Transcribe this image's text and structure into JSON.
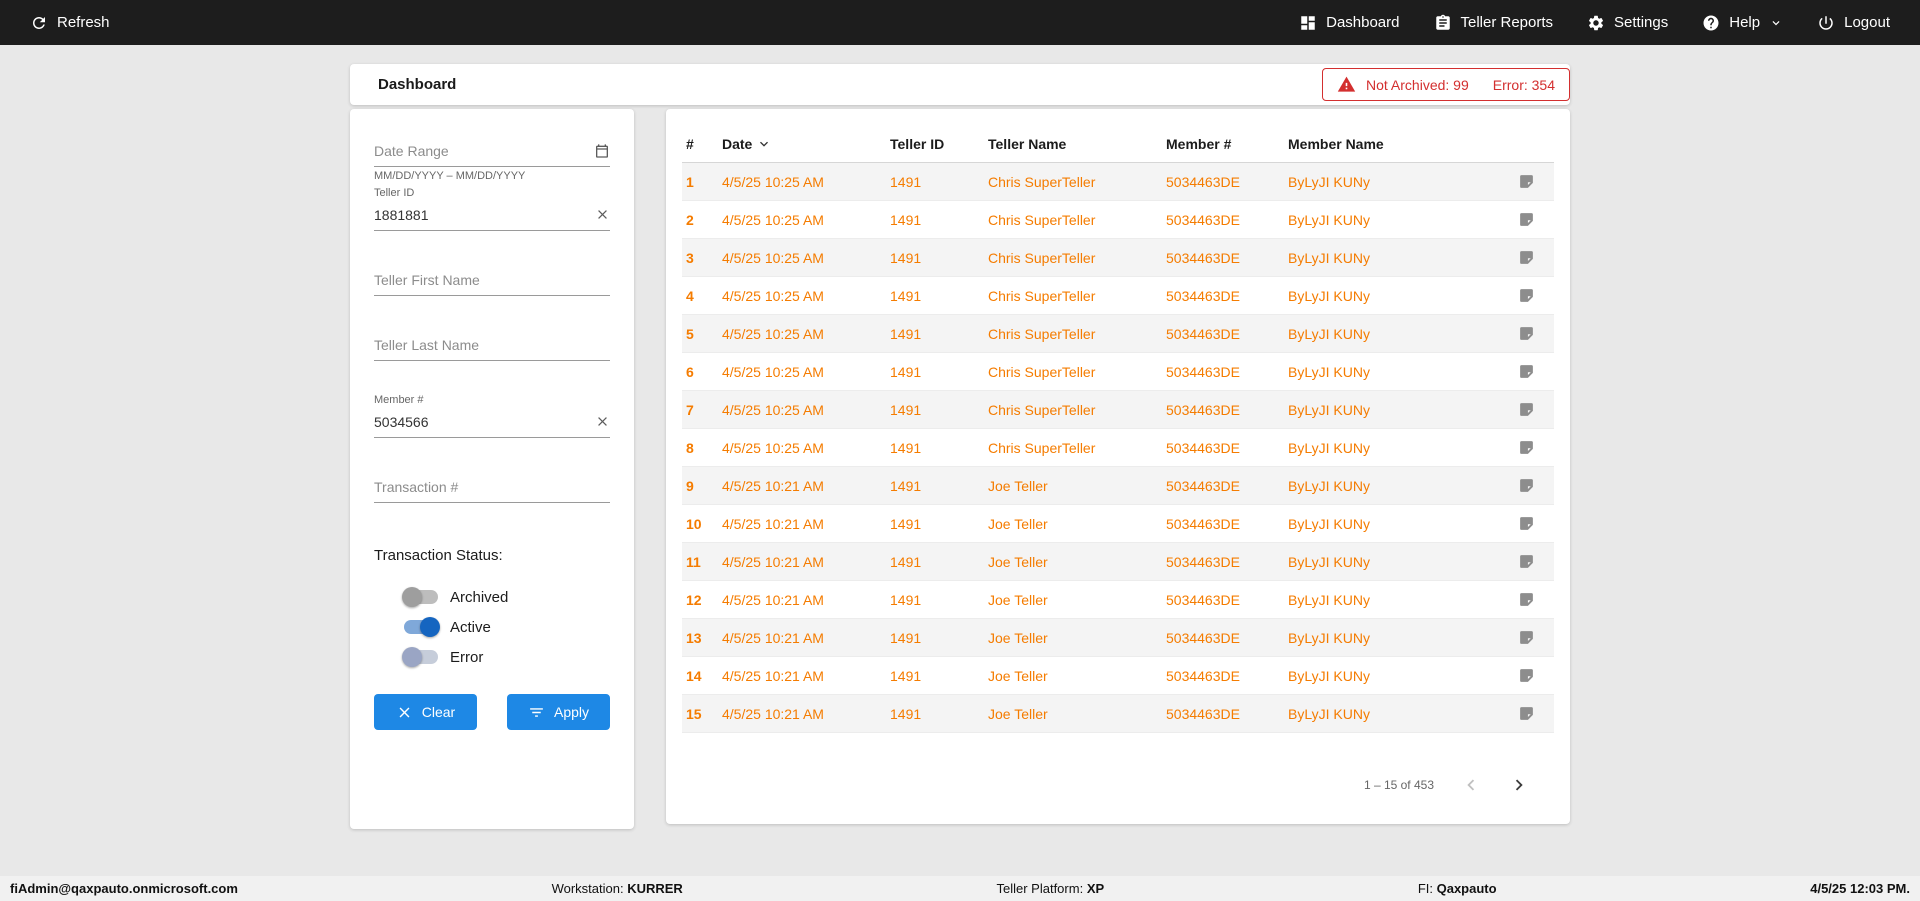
{
  "colors": {
    "topbar_bg": "#1d1d1d",
    "accent_orange": "#f57c00",
    "alert_red": "#d32f2f",
    "button_blue": "#1e88e5",
    "toggle_on_blue": "#1565c0"
  },
  "topbar": {
    "refresh_label": "Refresh",
    "nav": [
      {
        "label": "Dashboard"
      },
      {
        "label": "Teller Reports"
      },
      {
        "label": "Settings"
      },
      {
        "label": "Help"
      },
      {
        "label": "Logout"
      }
    ]
  },
  "header": {
    "title": "Dashboard",
    "alert": {
      "not_archived": "Not Archived: 99",
      "error": "Error: 354"
    }
  },
  "filters": {
    "date_range": {
      "placeholder": "Date Range",
      "helper": "MM/DD/YYYY – MM/DD/YYYY"
    },
    "teller_id": {
      "label": "Teller ID",
      "value": "1881881"
    },
    "teller_first_name": {
      "placeholder": "Teller First Name"
    },
    "teller_last_name": {
      "placeholder": "Teller Last Name"
    },
    "member_number": {
      "label": "Member #",
      "value": "5034566"
    },
    "transaction_number": {
      "placeholder": "Transaction #"
    },
    "status": {
      "label": "Transaction Status:",
      "archived": {
        "label": "Archived",
        "on": false
      },
      "active": {
        "label": "Active",
        "on": true
      },
      "error": {
        "label": "Error",
        "on": false
      }
    },
    "clear_label": "Clear",
    "apply_label": "Apply"
  },
  "table": {
    "columns": [
      "#",
      "Date",
      "Teller ID",
      "Teller Name",
      "Member #",
      "Member Name"
    ],
    "rows": [
      {
        "num": "1",
        "date": "4/5/25 10:25 AM",
        "teller_id": "1491",
        "teller_name": "Chris SuperTeller",
        "member_number": "5034463DE",
        "member_name": "ByLyJI KUNy"
      },
      {
        "num": "2",
        "date": "4/5/25 10:25 AM",
        "teller_id": "1491",
        "teller_name": "Chris SuperTeller",
        "member_number": "5034463DE",
        "member_name": "ByLyJI KUNy"
      },
      {
        "num": "3",
        "date": "4/5/25 10:25 AM",
        "teller_id": "1491",
        "teller_name": "Chris SuperTeller",
        "member_number": "5034463DE",
        "member_name": "ByLyJI KUNy"
      },
      {
        "num": "4",
        "date": "4/5/25 10:25 AM",
        "teller_id": "1491",
        "teller_name": "Chris SuperTeller",
        "member_number": "5034463DE",
        "member_name": "ByLyJI KUNy"
      },
      {
        "num": "5",
        "date": "4/5/25 10:25 AM",
        "teller_id": "1491",
        "teller_name": "Chris SuperTeller",
        "member_number": "5034463DE",
        "member_name": "ByLyJI KUNy"
      },
      {
        "num": "6",
        "date": "4/5/25 10:25 AM",
        "teller_id": "1491",
        "teller_name": "Chris SuperTeller",
        "member_number": "5034463DE",
        "member_name": "ByLyJI KUNy"
      },
      {
        "num": "7",
        "date": "4/5/25 10:25 AM",
        "teller_id": "1491",
        "teller_name": "Chris SuperTeller",
        "member_number": "5034463DE",
        "member_name": "ByLyJI KUNy"
      },
      {
        "num": "8",
        "date": "4/5/25 10:25 AM",
        "teller_id": "1491",
        "teller_name": "Chris SuperTeller",
        "member_number": "5034463DE",
        "member_name": "ByLyJI KUNy"
      },
      {
        "num": "9",
        "date": "4/5/25 10:21 AM",
        "teller_id": "1491",
        "teller_name": "Joe Teller",
        "member_number": "5034463DE",
        "member_name": "ByLyJI KUNy"
      },
      {
        "num": "10",
        "date": "4/5/25 10:21 AM",
        "teller_id": "1491",
        "teller_name": "Joe Teller",
        "member_number": "5034463DE",
        "member_name": "ByLyJI KUNy"
      },
      {
        "num": "11",
        "date": "4/5/25 10:21 AM",
        "teller_id": "1491",
        "teller_name": "Joe Teller",
        "member_number": "5034463DE",
        "member_name": "ByLyJI KUNy"
      },
      {
        "num": "12",
        "date": "4/5/25 10:21 AM",
        "teller_id": "1491",
        "teller_name": "Joe Teller",
        "member_number": "5034463DE",
        "member_name": "ByLyJI KUNy"
      },
      {
        "num": "13",
        "date": "4/5/25 10:21 AM",
        "teller_id": "1491",
        "teller_name": "Joe Teller",
        "member_number": "5034463DE",
        "member_name": "ByLyJI KUNy"
      },
      {
        "num": "14",
        "date": "4/5/25 10:21 AM",
        "teller_id": "1491",
        "teller_name": "Joe Teller",
        "member_number": "5034463DE",
        "member_name": "ByLyJI KUNy"
      },
      {
        "num": "15",
        "date": "4/5/25 10:21 AM",
        "teller_id": "1491",
        "teller_name": "Joe Teller",
        "member_number": "5034463DE",
        "member_name": "ByLyJI KUNy"
      }
    ],
    "pagination": "1 – 15 of 453"
  },
  "footer": {
    "email": "fiAdmin@qaxpauto.onmicrosoft.com",
    "workstation_label": "Workstation:",
    "workstation": "KURRER",
    "platform_label": "Teller Platform:",
    "platform": "XP",
    "fi_label": "FI:",
    "fi": "Qaxpauto",
    "datetime": "4/5/25 12:03 PM."
  }
}
